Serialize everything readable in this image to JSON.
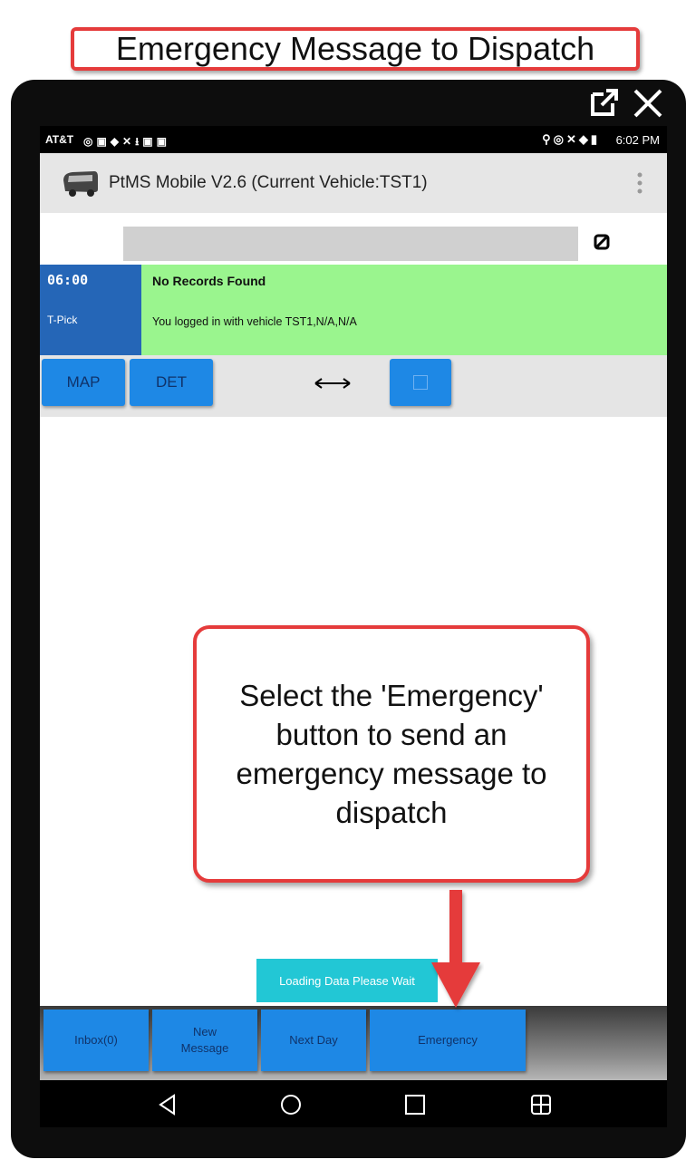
{
  "banner": {
    "title": "Emergency Message to Dispatch"
  },
  "statusbar": {
    "carrier": "AT&T",
    "time": "6:02 PM"
  },
  "appbar": {
    "title": "PtMS Mobile V2.6  (Current Vehicle:TST1)"
  },
  "trip": {
    "time": "06:00",
    "type": "T-Pick",
    "title": "No Records Found",
    "message": "You logged in with vehicle TST1,N/A,N/A"
  },
  "actions": {
    "map_label": "MAP",
    "det_label": "DET"
  },
  "toast": {
    "text": "Loading Data Please Wait"
  },
  "bottom_buttons": [
    {
      "label": "Inbox(0)"
    },
    {
      "label": "New Message"
    },
    {
      "label": "Next Day"
    },
    {
      "label": "Emergency"
    }
  ],
  "callout": {
    "text": "Select the 'Emergency' button to send an emergency message to dispatch"
  },
  "colors": {
    "accent_red": "#e53b3b",
    "button_blue": "#1e88e5",
    "trip_blue": "#2566b7",
    "record_green": "#9af58e",
    "toast_cyan": "#22c7d5"
  }
}
